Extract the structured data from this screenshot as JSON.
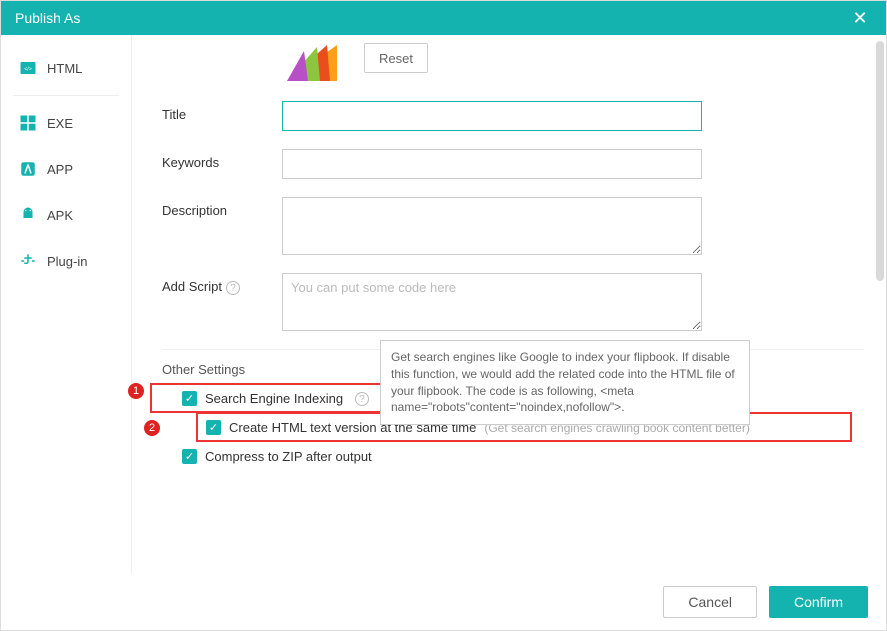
{
  "titlebar": {
    "title": "Publish As"
  },
  "sidebar": {
    "items": [
      {
        "label": "HTML"
      },
      {
        "label": "EXE"
      },
      {
        "label": "APP"
      },
      {
        "label": "APK"
      },
      {
        "label": "Plug-in"
      }
    ]
  },
  "form": {
    "reset_label": "Reset",
    "title_label": "Title",
    "keywords_label": "Keywords",
    "description_label": "Description",
    "addscript_label": "Add Script",
    "addscript_placeholder": "You can put some code here"
  },
  "other": {
    "heading": "Other Settings",
    "se_indexing": "Search Engine Indexing",
    "create_html_text": "Create HTML text version at the same time",
    "create_html_hint": "(Get search engines crawling book content better)",
    "compress_zip": "Compress to ZIP after output"
  },
  "tooltip": {
    "text": " Get search engines like Google to index your flipbook. If disable this function, we would add the related code into the HTML file of your flipbook. The code is as following, <meta name=\"robots\"content=\"noindex,nofollow\">."
  },
  "footer": {
    "cancel": "Cancel",
    "confirm": "Confirm"
  },
  "annotations": {
    "badge1": "1",
    "badge2": "2"
  }
}
